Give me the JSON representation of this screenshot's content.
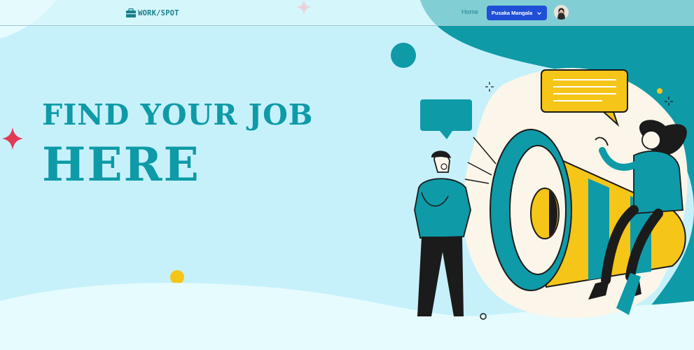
{
  "brand": {
    "name": "WORK/SPOT",
    "icon": "briefcase-icon"
  },
  "nav": {
    "home_label": "Home",
    "user_name": "Pusaka Mangala",
    "user_menu_icon": "chevron-down-icon"
  },
  "hero": {
    "line1": "FIND YOUR JOB",
    "line2": "HERE"
  },
  "colors": {
    "accent": "#0e9aa7",
    "background": "#c6f1fb",
    "button": "#1f4fd6",
    "sparkle": "#e23b56",
    "dot": "#f5c518"
  }
}
